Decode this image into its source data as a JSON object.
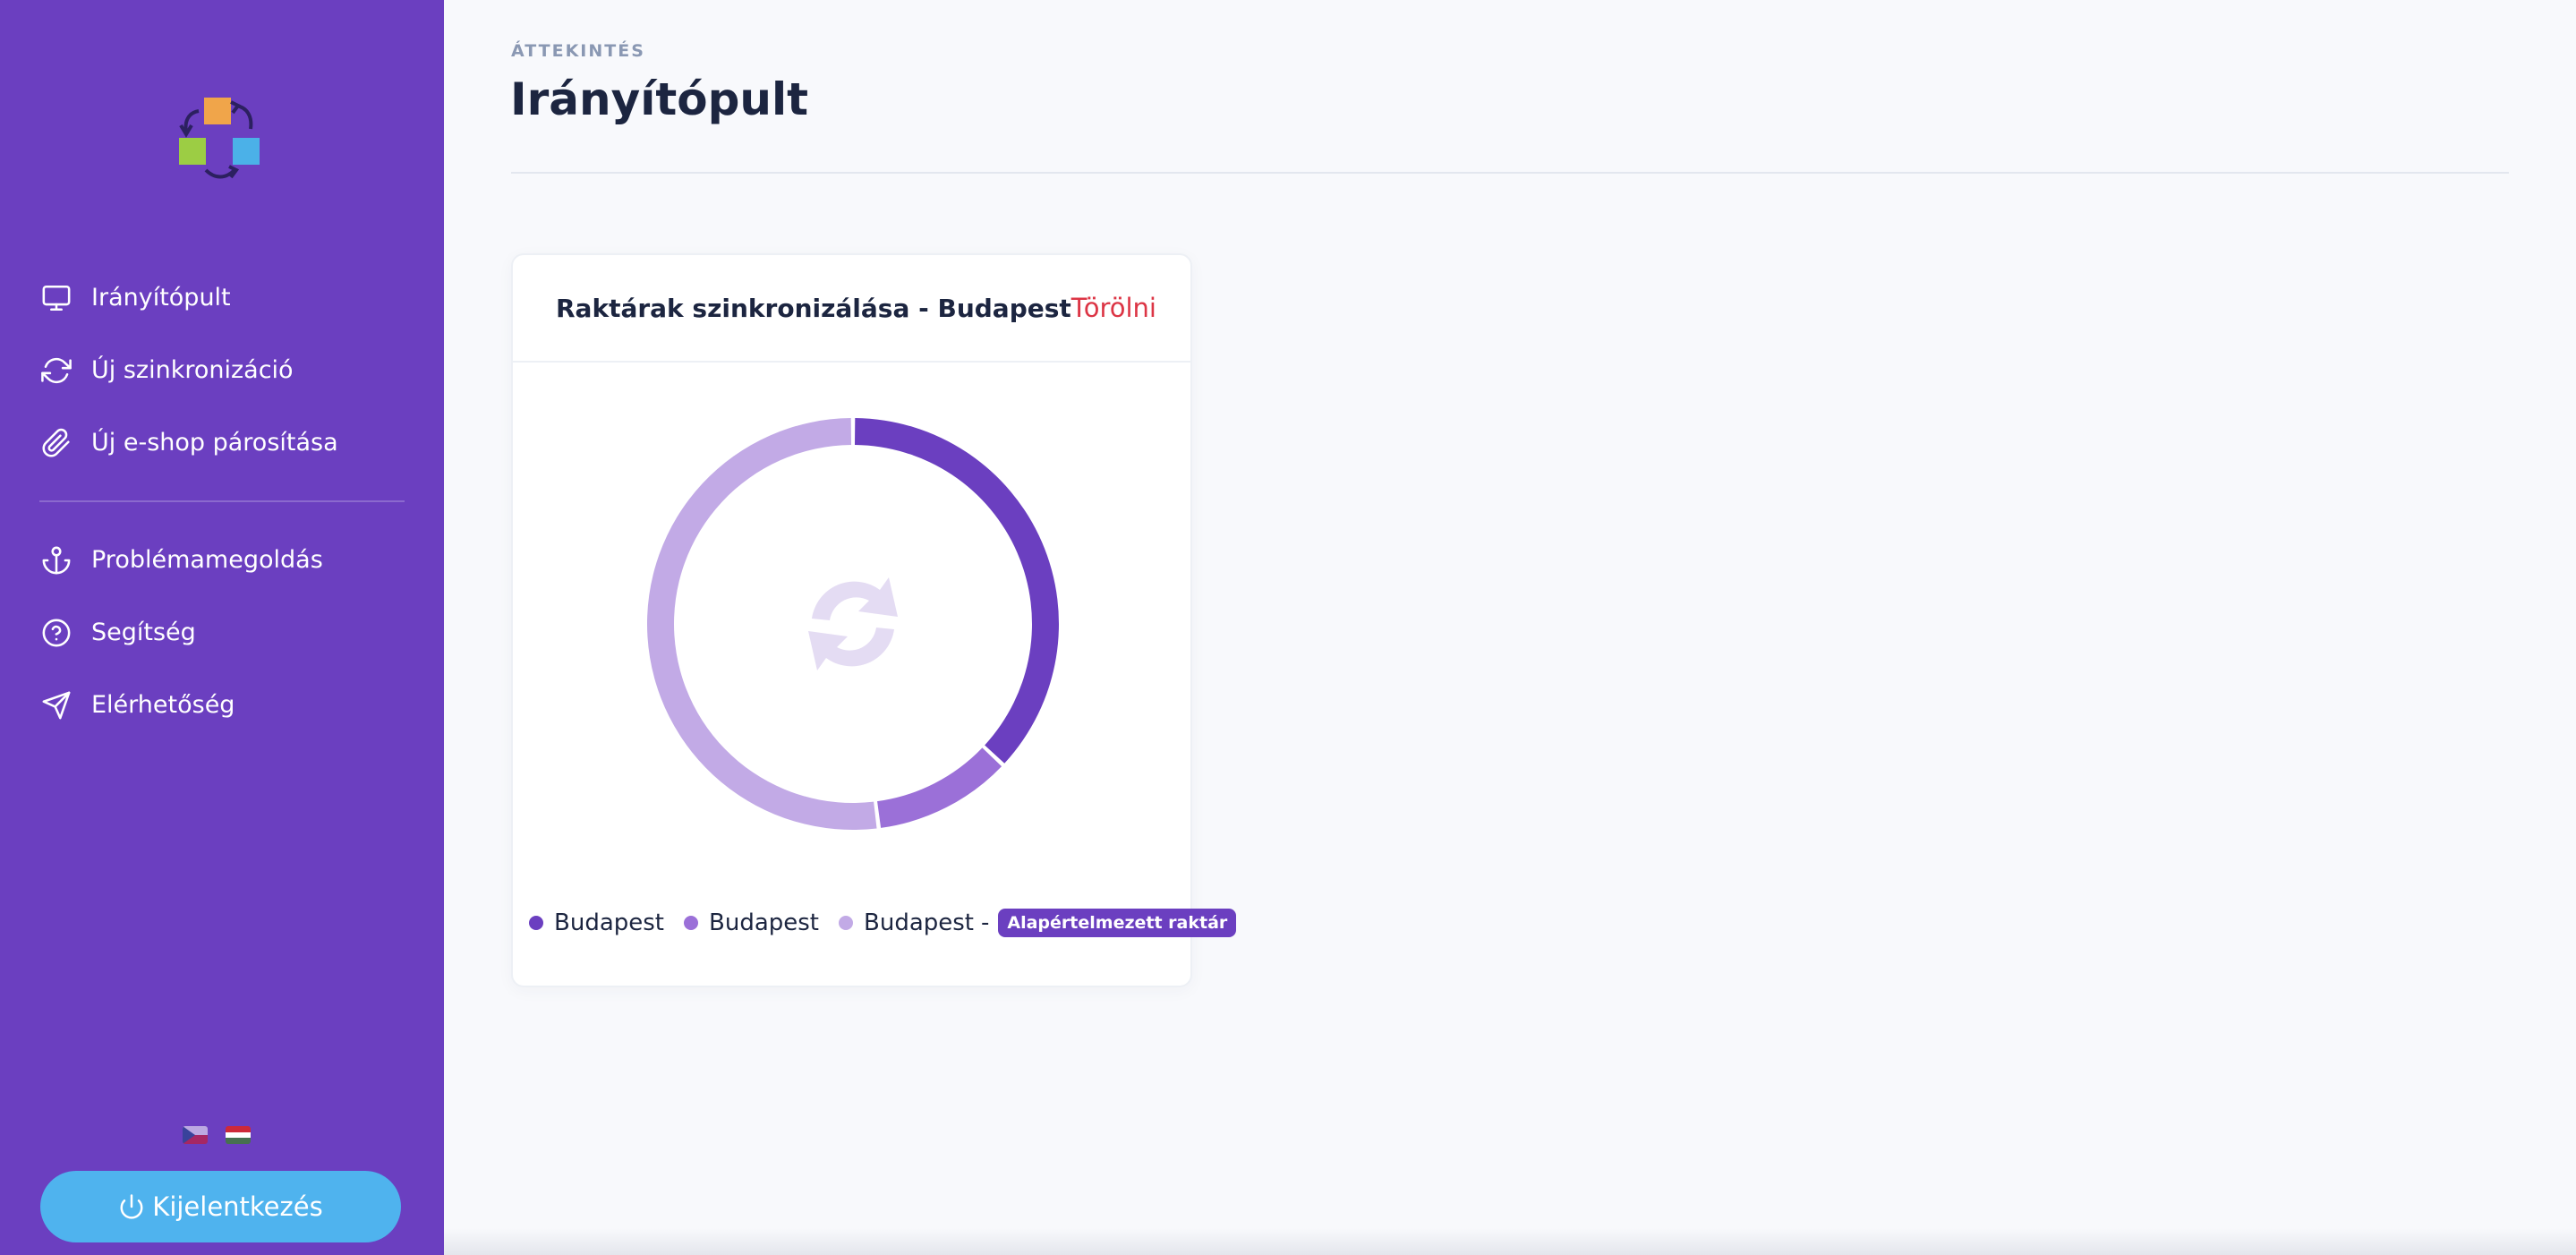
{
  "colors": {
    "sidebar_bg": "#6b3fc0",
    "logout_bg": "#4fb3ee",
    "delete_text": "#dc3545",
    "series": [
      "#6b3fc0",
      "#9b70d8",
      "#c2aae6"
    ]
  },
  "sidebar": {
    "nav": [
      {
        "label": "Irányítópult",
        "icon": "monitor-icon"
      },
      {
        "label": "Új szinkronizáció",
        "icon": "sync-icon"
      },
      {
        "label": "Új e-shop párosítása",
        "icon": "paperclip-icon"
      }
    ],
    "nav_secondary": [
      {
        "label": "Problémamegoldás",
        "icon": "anchor-icon"
      },
      {
        "label": "Segítség",
        "icon": "help-circle-icon"
      },
      {
        "label": "Elérhetőség",
        "icon": "send-icon"
      }
    ],
    "languages": [
      "cz-flag-icon",
      "hu-flag-icon"
    ],
    "logout_label": "Kijelentkezés"
  },
  "header": {
    "overline": "ÁTTEKINTÉS",
    "title": "Irányítópult"
  },
  "card": {
    "title": "Raktárak szinkronizálása - Budapest",
    "delete_label": "Törölni",
    "legend": [
      {
        "label": "Budapest"
      },
      {
        "label": "Budapest"
      },
      {
        "label": "Budapest",
        "suffix": "-",
        "badge": "Alapértelmezett raktár"
      }
    ]
  },
  "chart_data": {
    "type": "pie",
    "variant": "donut",
    "categories": [
      "Budapest",
      "Budapest",
      "Budapest"
    ],
    "values": [
      37,
      11,
      52
    ],
    "colors": [
      "#6b3fc0",
      "#9b70d8",
      "#c2aae6"
    ],
    "legend": "bottom"
  }
}
